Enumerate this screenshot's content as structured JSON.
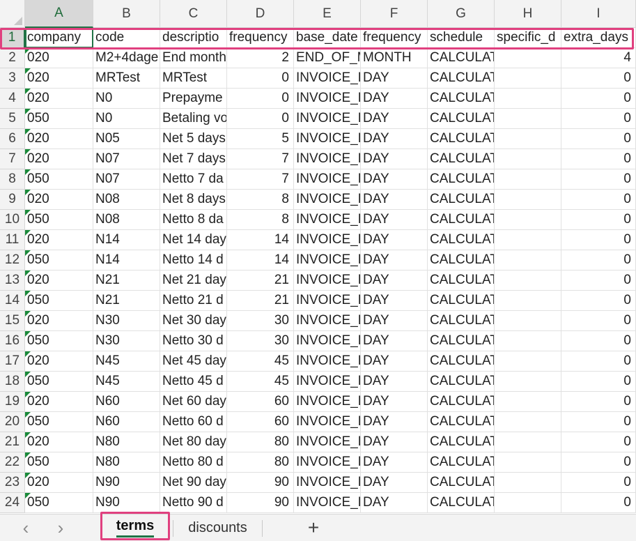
{
  "column_letters": [
    "A",
    "B",
    "C",
    "D",
    "E",
    "F",
    "G",
    "H",
    "I"
  ],
  "headers": [
    "company",
    "code",
    "descriptio",
    "frequency",
    "base_date",
    "frequency",
    "schedule",
    "specific_d",
    "extra_days"
  ],
  "rows": [
    {
      "n": "2",
      "c": [
        "020",
        "M2+4dage",
        "End month",
        "2",
        "END_OF_M",
        "MONTH",
        "CALCULATED_DAY",
        "",
        "4"
      ]
    },
    {
      "n": "3",
      "c": [
        "020",
        "MRTest",
        "MRTest",
        "0",
        "INVOICE_D",
        "DAY",
        "CALCULATED_DAY",
        "",
        "0"
      ]
    },
    {
      "n": "4",
      "c": [
        "020",
        "N0",
        "Prepayme",
        "0",
        "INVOICE_D",
        "DAY",
        "CALCULATED_DAY",
        "",
        "0"
      ]
    },
    {
      "n": "5",
      "c": [
        "050",
        "N0",
        "Betaling vo",
        "0",
        "INVOICE_D",
        "DAY",
        "CALCULATED_DAY",
        "",
        "0"
      ]
    },
    {
      "n": "6",
      "c": [
        "020",
        "N05",
        "Net 5 days",
        "5",
        "INVOICE_D",
        "DAY",
        "CALCULATED_DAY",
        "",
        "0"
      ]
    },
    {
      "n": "7",
      "c": [
        "020",
        "N07",
        "Net 7 days",
        "7",
        "INVOICE_D",
        "DAY",
        "CALCULATED_DAY",
        "",
        "0"
      ]
    },
    {
      "n": "8",
      "c": [
        "050",
        "N07",
        "Netto 7 da",
        "7",
        "INVOICE_D",
        "DAY",
        "CALCULATED_DAY",
        "",
        "0"
      ]
    },
    {
      "n": "9",
      "c": [
        "020",
        "N08",
        "Net 8 days",
        "8",
        "INVOICE_D",
        "DAY",
        "CALCULATED_DAY",
        "",
        "0"
      ]
    },
    {
      "n": "10",
      "c": [
        "050",
        "N08",
        "Netto 8 da",
        "8",
        "INVOICE_D",
        "DAY",
        "CALCULATED_DAY",
        "",
        "0"
      ]
    },
    {
      "n": "11",
      "c": [
        "020",
        "N14",
        "Net 14 day",
        "14",
        "INVOICE_D",
        "DAY",
        "CALCULATED_DAY",
        "",
        "0"
      ]
    },
    {
      "n": "12",
      "c": [
        "050",
        "N14",
        "Netto 14 d",
        "14",
        "INVOICE_D",
        "DAY",
        "CALCULATED_DAY",
        "",
        "0"
      ]
    },
    {
      "n": "13",
      "c": [
        "020",
        "N21",
        "Net 21 day",
        "21",
        "INVOICE_D",
        "DAY",
        "CALCULATED_DAY",
        "",
        "0"
      ]
    },
    {
      "n": "14",
      "c": [
        "050",
        "N21",
        "Netto 21 d",
        "21",
        "INVOICE_D",
        "DAY",
        "CALCULATED_DAY",
        "",
        "0"
      ]
    },
    {
      "n": "15",
      "c": [
        "020",
        "N30",
        "Net 30 day",
        "30",
        "INVOICE_D",
        "DAY",
        "CALCULATED_DAY",
        "",
        "0"
      ]
    },
    {
      "n": "16",
      "c": [
        "050",
        "N30",
        "Netto 30 d",
        "30",
        "INVOICE_D",
        "DAY",
        "CALCULATED_DAY",
        "",
        "0"
      ]
    },
    {
      "n": "17",
      "c": [
        "020",
        "N45",
        "Net 45 day",
        "45",
        "INVOICE_D",
        "DAY",
        "CALCULATED_DAY",
        "",
        "0"
      ]
    },
    {
      "n": "18",
      "c": [
        "050",
        "N45",
        "Netto 45 d",
        "45",
        "INVOICE_D",
        "DAY",
        "CALCULATED_DAY",
        "",
        "0"
      ]
    },
    {
      "n": "19",
      "c": [
        "020",
        "N60",
        "Net 60 day",
        "60",
        "INVOICE_D",
        "DAY",
        "CALCULATED_DAY",
        "",
        "0"
      ]
    },
    {
      "n": "20",
      "c": [
        "050",
        "N60",
        "Netto 60 d",
        "60",
        "INVOICE_D",
        "DAY",
        "CALCULATED_DAY",
        "",
        "0"
      ]
    },
    {
      "n": "21",
      "c": [
        "020",
        "N80",
        "Net 80 day",
        "80",
        "INVOICE_D",
        "DAY",
        "CALCULATED_DAY",
        "",
        "0"
      ]
    },
    {
      "n": "22",
      "c": [
        "050",
        "N80",
        "Netto 80 d",
        "80",
        "INVOICE_D",
        "DAY",
        "CALCULATED_DAY",
        "",
        "0"
      ]
    },
    {
      "n": "23",
      "c": [
        "020",
        "N90",
        "Net 90 day",
        "90",
        "INVOICE_D",
        "DAY",
        "CALCULATED_DAY",
        "",
        "0"
      ]
    },
    {
      "n": "24",
      "c": [
        "050",
        "N90",
        "Netto 90 d",
        "90",
        "INVOICE_D",
        "DAY",
        "CALCULATED_DAY",
        "",
        "0"
      ]
    }
  ],
  "header_row_number": "1",
  "sheet_tabs": [
    "terms",
    "discounts"
  ],
  "active_tab": "terms",
  "nav": {
    "prev": "‹",
    "next": "›",
    "add": "+"
  },
  "colors": {
    "accent": "#217346",
    "highlight": "#e0407f"
  }
}
